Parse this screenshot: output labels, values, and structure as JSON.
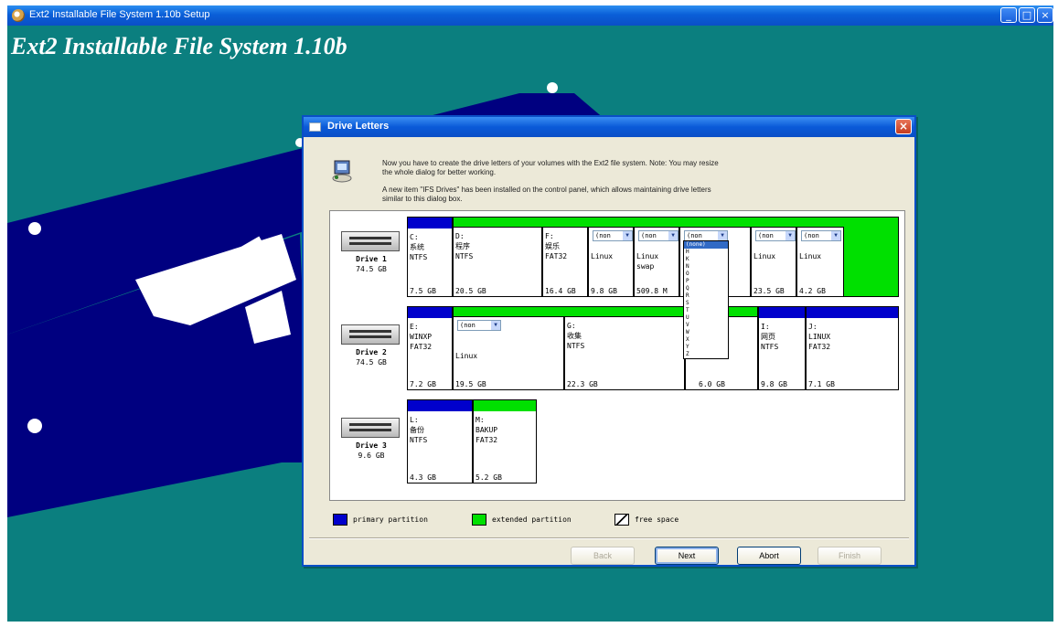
{
  "window": {
    "title": "Ext2 Installable File System 1.10b Setup",
    "heading": "Ext2 Installable File System 1.10b",
    "min_glyph": "_",
    "max_glyph": "□",
    "close_glyph": "×"
  },
  "dialog": {
    "title": "Drive Letters",
    "close_glyph": "×",
    "info_line1": "Now you have to create the drive letters of your volumes with the Ext2 file system. Note: You may resize",
    "info_line2": "the whole dialog for better working.",
    "info_line3": "A new item \"IFS Drives\" has been installed on the control panel, which allows maintaining drive letters",
    "info_line4": "similar to this dialog box."
  },
  "drives": [
    {
      "name": "Drive 1",
      "size": "74.5 GB",
      "partitions": [
        {
          "type": "primary",
          "letter": "C:",
          "label": "系统",
          "fs": "NTFS",
          "size": "7.5 GB"
        },
        {
          "type": "extended",
          "letter": "D:",
          "label": "程序",
          "fs": "NTFS",
          "size": "20.5 GB"
        },
        {
          "type": "extended",
          "letter": "F:",
          "label": "娱乐",
          "fs": "FAT32",
          "size": "16.4 GB"
        },
        {
          "type": "extended",
          "combo": "(non",
          "fs": "Linux",
          "size": "9.8 GB"
        },
        {
          "type": "extended",
          "combo": "(non",
          "fs": "Linux",
          "fs2": "swap",
          "size": "509.8 M"
        },
        {
          "type": "extended",
          "combo": "(non",
          "size": ""
        },
        {
          "type": "extended",
          "combo": "(non",
          "fs": "Linux",
          "size": "23.5 GB"
        },
        {
          "type": "extended",
          "combo": "(non",
          "fs": "Linux",
          "size": "4.2 GB"
        }
      ]
    },
    {
      "name": "Drive 2",
      "size": "74.5 GB",
      "partitions": [
        {
          "type": "primary",
          "letter": "E:",
          "label": "WINXP",
          "fs": "FAT32",
          "size": "7.2 GB"
        },
        {
          "type": "extended",
          "combo": "(non",
          "fs": "Linux",
          "size": "19.5 GB"
        },
        {
          "type": "extended",
          "letter": "G:",
          "label": "收集",
          "fs": "NTFS",
          "size": "22.3 GB"
        },
        {
          "type": "extended",
          "size": "6.0 GB"
        },
        {
          "type": "primary",
          "letter": "I:",
          "label": "网页",
          "fs": "NTFS",
          "size": "9.8 GB"
        },
        {
          "type": "primary",
          "letter": "J:",
          "label": "LINUX",
          "fs": "FAT32",
          "size": "7.1 GB"
        }
      ]
    },
    {
      "name": "Drive 3",
      "size": "9.6 GB",
      "partitions": [
        {
          "type": "primary",
          "letter": "L:",
          "label": "备份",
          "fs": "NTFS",
          "size": "4.3 GB"
        },
        {
          "type": "extended",
          "letter": "M:",
          "label": "BAKUP",
          "fs": "FAT32",
          "size": "5.2 GB"
        }
      ]
    }
  ],
  "dropdown": {
    "selected": "(none)",
    "options": [
      "H",
      "K",
      "N",
      "O",
      "P",
      "Q",
      "R",
      "S",
      "T",
      "U",
      "V",
      "W",
      "X",
      "Y",
      "Z"
    ]
  },
  "legend": {
    "primary": "primary partition",
    "extended": "extended partition",
    "free": "free space"
  },
  "buttons": {
    "back": "Back",
    "next": "Next",
    "abort": "Abort",
    "finish": "Finish"
  },
  "colors": {
    "desktop": "#0b7f7f",
    "primary": "#0000cc",
    "extended": "#00e000",
    "titlebar": "#0a4fc6"
  }
}
